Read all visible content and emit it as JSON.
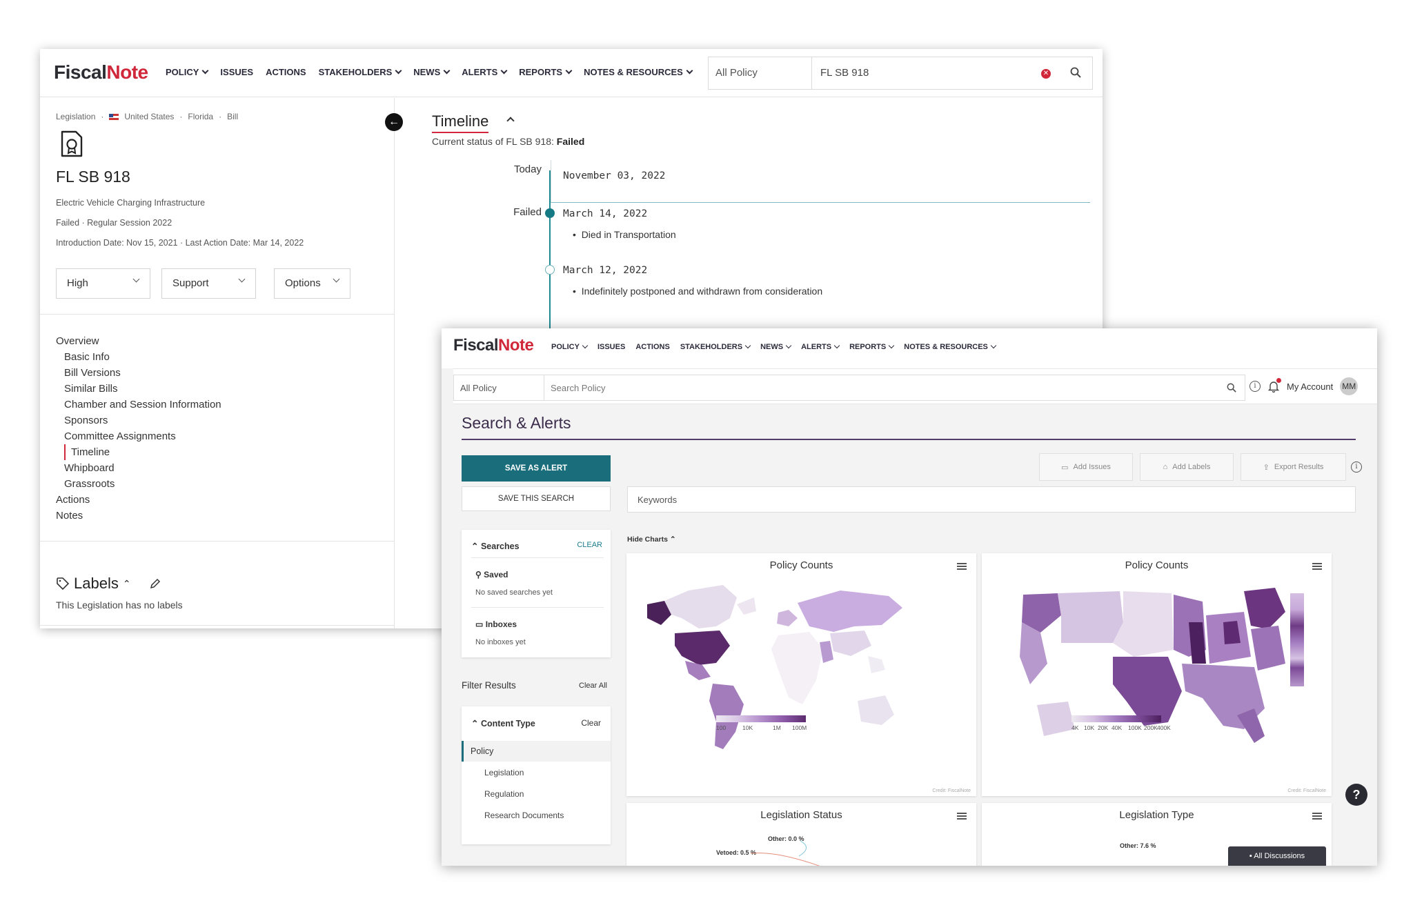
{
  "brand": {
    "fiscal": "Fiscal",
    "note": "Note"
  },
  "nav": {
    "items": [
      {
        "label": "POLICY",
        "caret": true
      },
      {
        "label": "ISSUES",
        "caret": false
      },
      {
        "label": "ACTIONS",
        "caret": false
      },
      {
        "label": "STAKEHOLDERS",
        "caret": true
      },
      {
        "label": "NEWS",
        "caret": true
      },
      {
        "label": "ALERTS",
        "caret": true
      },
      {
        "label": "REPORTS",
        "caret": true
      },
      {
        "label": "NOTES & RESOURCES",
        "caret": true
      }
    ]
  },
  "window1": {
    "search": {
      "scope": "All Policy",
      "query": "FL SB 918"
    },
    "breadcrumb": {
      "type": "Legislation",
      "country": "United States",
      "state": "Florida",
      "kind": "Bill"
    },
    "bill": {
      "title": "FL SB 918",
      "description": "Electric Vehicle Charging Infrastructure",
      "status_line": "Failed  ·  Regular Session 2022",
      "dates_line": "Introduction Date: Nov 15, 2021  ·  Last Action Date: Mar 14, 2022"
    },
    "dropdowns": {
      "priority": "High",
      "position": "Support",
      "options": "Options"
    },
    "toc": {
      "overview": "Overview",
      "items": [
        "Basic Info",
        "Bill Versions",
        "Similar Bills",
        "Chamber and Session Information",
        "Sponsors",
        "Committee Assignments",
        "Timeline",
        "Whipboard",
        "Grassroots"
      ],
      "actions": "Actions",
      "notes": "Notes"
    },
    "labels": {
      "title": "Labels",
      "empty": "This Legislation has no labels"
    },
    "timeline": {
      "title": "Timeline",
      "status_prefix": "Current status of FL SB 918: ",
      "status_value": "Failed",
      "today_label": "Today",
      "today_date": "November 03, 2022",
      "events": [
        {
          "label": "Failed",
          "date": "March 14, 2022",
          "note": "Died in Transportation"
        },
        {
          "label": "",
          "date": "March 12, 2022",
          "note": "Indefinitely postponed and withdrawn from consideration"
        }
      ]
    }
  },
  "window2": {
    "search": {
      "scope": "All Policy",
      "placeholder": "Search Policy"
    },
    "account": {
      "label": "My Account",
      "initials": "MM"
    },
    "page_title": "Search & Alerts",
    "buttons": {
      "save_alert": "SAVE AS ALERT",
      "save_search": "SAVE THIS SEARCH",
      "add_issues": "Add Issues",
      "add_labels": "Add Labels",
      "export": "Export Results"
    },
    "keywords_placeholder": "Keywords",
    "hide_charts": "Hide Charts",
    "searches": {
      "title": "Searches",
      "clear": "CLEAR",
      "saved_title": "Saved",
      "saved_empty": "No saved searches yet",
      "inboxes_title": "Inboxes",
      "inboxes_empty": "No inboxes yet"
    },
    "filter": {
      "title": "Filter Results",
      "clear_all": "Clear All",
      "content_type": "Content Type",
      "clear": "Clear",
      "selected": "Policy",
      "options": [
        "Legislation",
        "Regulation",
        "Research Documents"
      ]
    },
    "charts": [
      {
        "title": "Policy Counts",
        "legend_ticks": [
          "100",
          "10K",
          "1M",
          "100M"
        ],
        "credit": "Credit: FiscalNote"
      },
      {
        "title": "Policy Counts",
        "legend_ticks": [
          "4K",
          "10K",
          "20K",
          "40K",
          "100K",
          "200K",
          "400K"
        ],
        "credit": "Credit: FiscalNote"
      },
      {
        "title": "Legislation Status",
        "labels": [
          "Other: 0.0 %",
          "Vetoed: 0.5 %"
        ]
      },
      {
        "title": "Legislation Type",
        "labels": [
          "Other: 7.6 %"
        ]
      }
    ],
    "discussions": "All Discussions",
    "help": "?"
  }
}
